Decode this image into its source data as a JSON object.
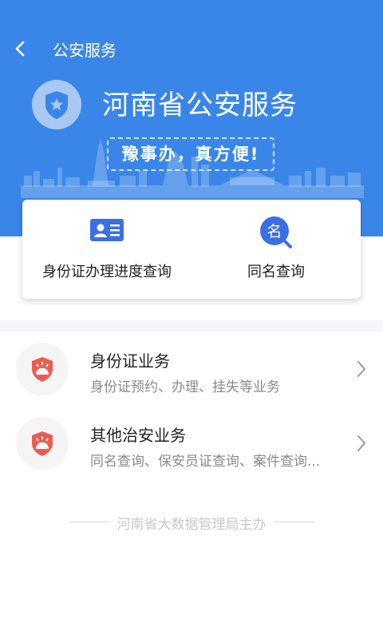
{
  "header": {
    "back_icon": "chevron-left-icon",
    "title": "公安服务"
  },
  "hero": {
    "brand_icon": "shield-star-icon",
    "brand_title": "河南省公安服务",
    "slogan": "豫事办，真方便!",
    "background_color": "#3a86e8"
  },
  "quick_actions": [
    {
      "icon": "id-card-icon",
      "label": "身份证办理进度查询",
      "color": "#3b6fe6"
    },
    {
      "icon": "name-search-icon",
      "label": "同名查询",
      "color": "#3b6fe6",
      "glyph": "名"
    }
  ],
  "services": [
    {
      "icon": "police-shield-icon",
      "title": "身份证业务",
      "subtitle": "身份证预约、办理、挂失等业务"
    },
    {
      "icon": "police-shield-icon",
      "title": "其他治安业务",
      "subtitle": "同名查询、保安员证查询、案件查询..."
    }
  ],
  "footer": {
    "text": "河南省大数据管理局主办"
  },
  "colors": {
    "accent": "#3a86e8",
    "service_icon": "#ee5b4f"
  }
}
